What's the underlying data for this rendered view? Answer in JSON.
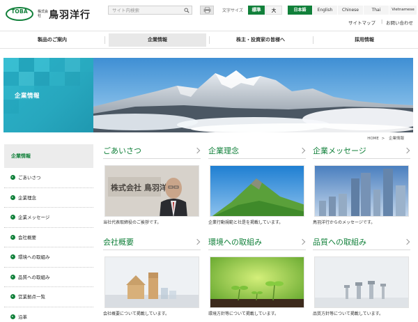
{
  "header": {
    "logo_mark": "TOBA",
    "logo_kabushiki": "株式会社",
    "logo_name": "鳥羽洋行",
    "search_placeholder": "サイト内検索",
    "font_size_label": "文字サイズ",
    "font_size_options": [
      "標準",
      "大"
    ],
    "languages": [
      "日本語",
      "English",
      "Chinese",
      "Thai",
      "Vietnamese"
    ],
    "util_links": [
      "サイトマップ",
      "お問い合わせ"
    ],
    "util_separator": "|"
  },
  "nav": {
    "items": [
      "製品のご案内",
      "企業情報",
      "株主・投資家の皆様へ",
      "採用情報"
    ],
    "active_index": 1
  },
  "hero": {
    "title": "企業情報"
  },
  "breadcrumb": {
    "items": [
      "HOME",
      "企業情報"
    ],
    "separator": ">"
  },
  "sidebar": {
    "heading": "企業情報",
    "items": [
      "ごあいさつ",
      "企業理念",
      "企業メッセージ",
      "会社概要",
      "環境への取組み",
      "品質への取組み",
      "営業拠点一覧",
      "沿革"
    ]
  },
  "cards": [
    {
      "title": "ごあいさつ",
      "desc": "当社代表取締役のご挨拶です。",
      "sign_text": "株式会社 鳥羽洋行"
    },
    {
      "title": "企業理念",
      "desc": "企業行動規範と社是を掲載しています。"
    },
    {
      "title": "企業メッセージ",
      "desc": "鳥羽洋行からのメッセージです。"
    },
    {
      "title": "会社概要",
      "desc": "会社概要について掲載しています。"
    },
    {
      "title": "環境への取組み",
      "desc": "環境方針等について掲載しています。"
    },
    {
      "title": "品質への取組み",
      "desc": "品質方針等について掲載しています。"
    }
  ],
  "colors": {
    "brand_green": "#11803a",
    "hero_teal": "#2bb3c9",
    "nav_active_bg": "#e8e8e8"
  }
}
